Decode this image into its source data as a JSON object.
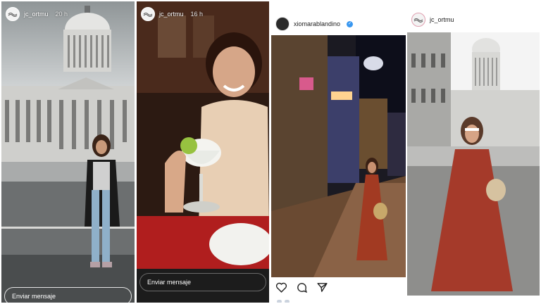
{
  "stories": [
    {
      "username": "jc_ortmu",
      "time_ago": "20 h",
      "message_placeholder": "Enviar mensaje"
    },
    {
      "username": "jc_ortmu",
      "time_ago": "16 h",
      "message_placeholder": "Enviar mensaje"
    }
  ],
  "post": {
    "username": "xiomarablandino",
    "verified": true,
    "icons": [
      "heart-icon",
      "comment-icon",
      "share-icon"
    ]
  },
  "post2": {
    "username": "jc_ortmu"
  },
  "colors": {
    "verified": "#3897f0",
    "border": "#ffffff"
  }
}
